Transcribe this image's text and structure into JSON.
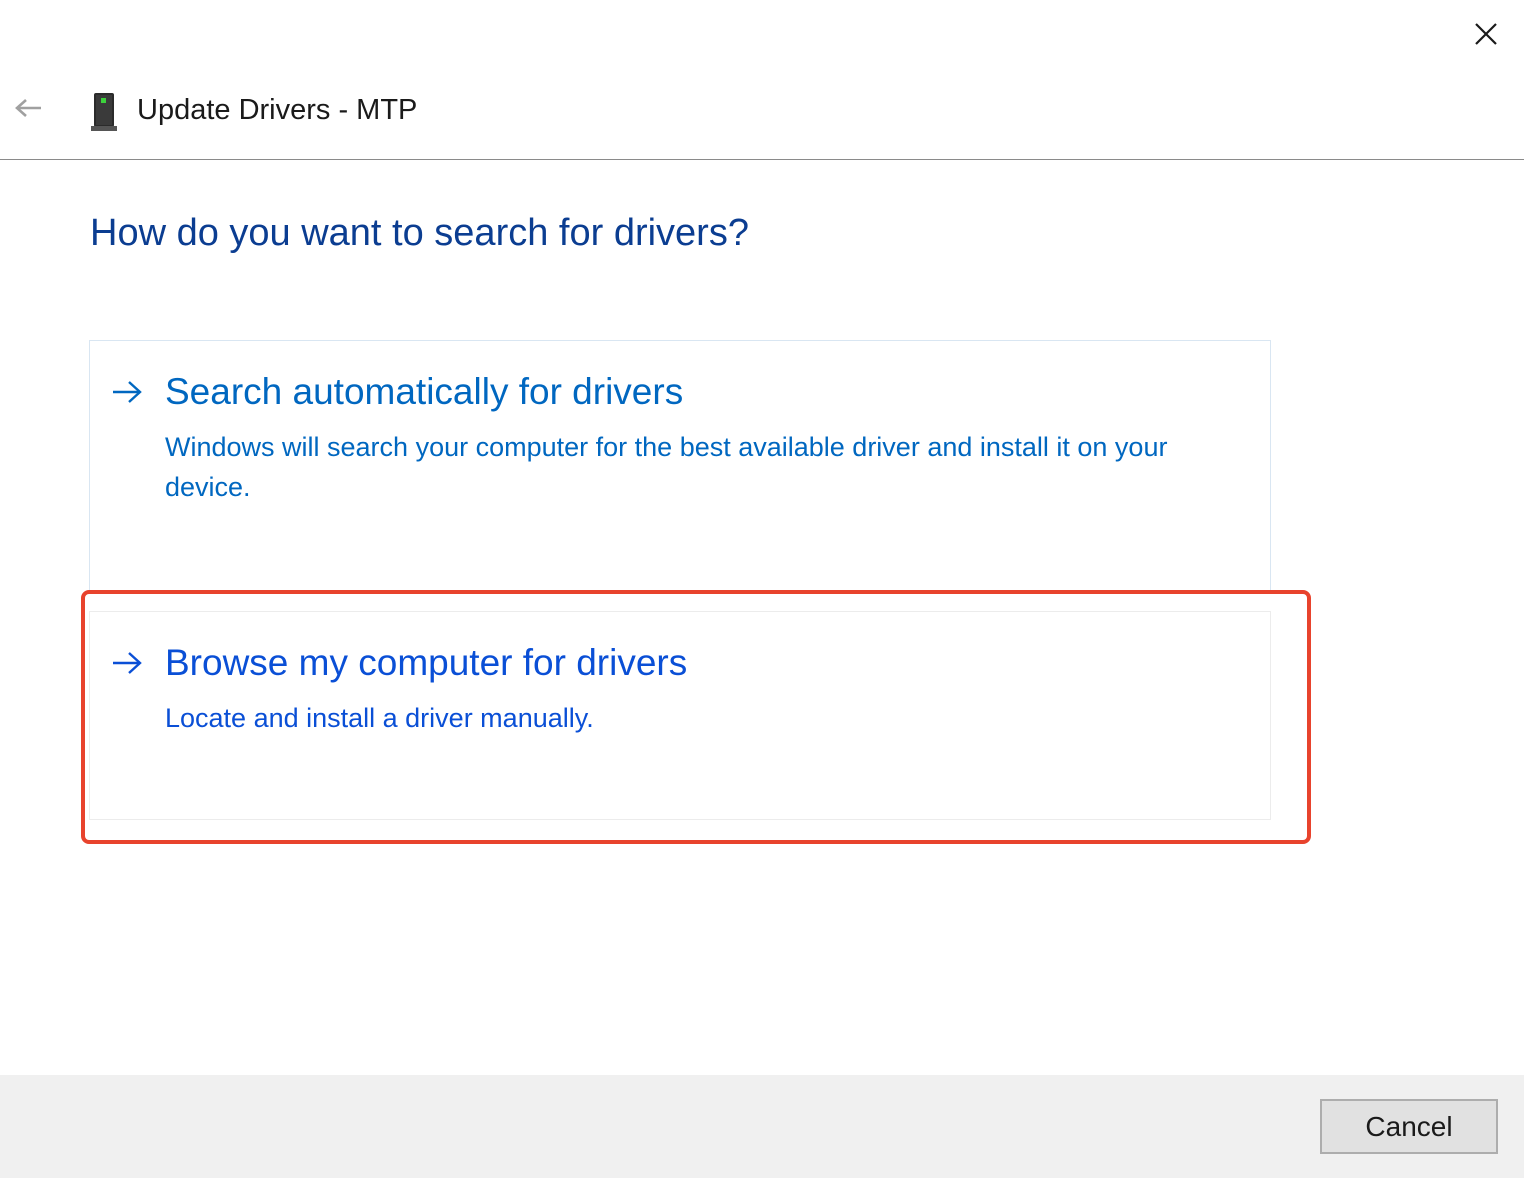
{
  "window": {
    "title": "Update Drivers - MTP"
  },
  "icons": {
    "close": "close-icon",
    "back": "back-arrow-icon",
    "device": "phone-device-icon",
    "option_arrow": "right-arrow-icon"
  },
  "main": {
    "question": "How do you want to search for drivers?",
    "options": [
      {
        "title": "Search automatically for drivers",
        "description": "Windows will search your computer for the best available driver and install it on your device."
      },
      {
        "title": "Browse my computer for drivers",
        "description": "Locate and install a driver manually.",
        "highlighted": true
      }
    ]
  },
  "footer": {
    "cancel_label": "Cancel"
  },
  "colors": {
    "link_blue": "#0067c0",
    "heading_blue": "#0b3d91",
    "highlight_red": "#e8432d",
    "footer_bg": "#f0f0f0"
  }
}
